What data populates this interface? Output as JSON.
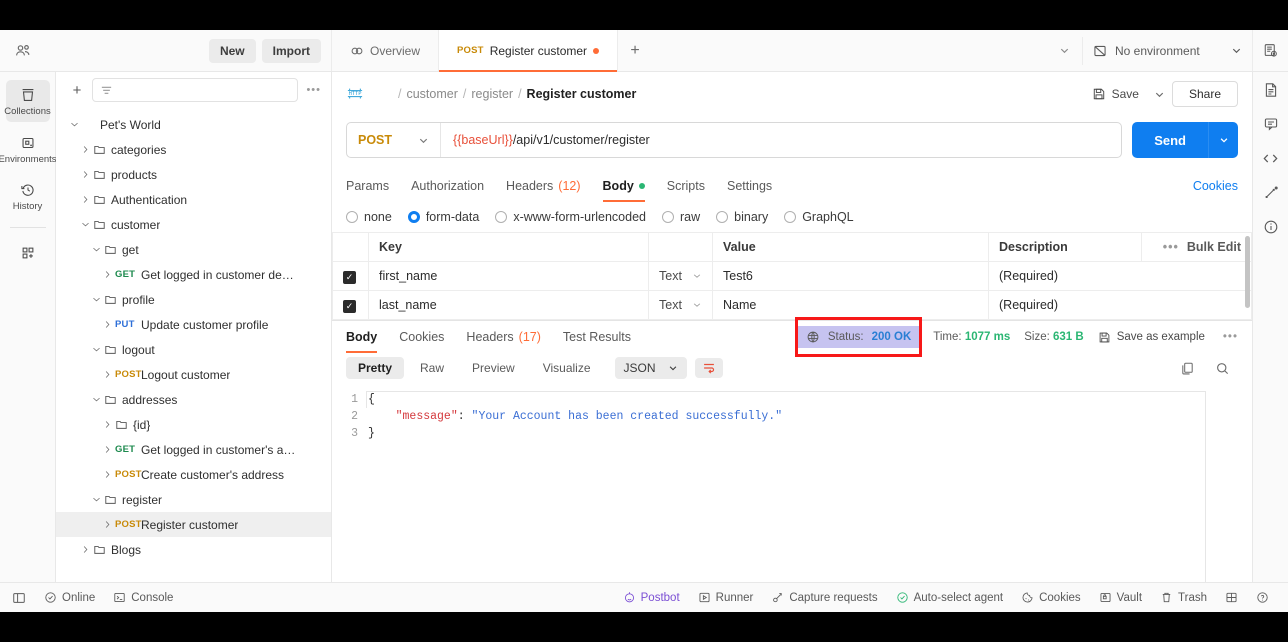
{
  "topbar": {
    "user_icon": "users-icon",
    "new_label": "New",
    "import_label": "Import",
    "environment": "No environment",
    "env_icon": "environment-icon",
    "tabs": [
      {
        "label": "Overview",
        "icon": "overview-icon",
        "method": "",
        "unsaved": false,
        "active": false
      },
      {
        "label": "Register customer",
        "icon": "",
        "method": "POST",
        "unsaved": true,
        "active": true
      }
    ],
    "new_tab_label": "+"
  },
  "rail": {
    "items": [
      {
        "label": "Collections",
        "icon": "collections-icon",
        "active": true
      },
      {
        "label": "Environments",
        "icon": "environments-icon",
        "active": false
      },
      {
        "label": "History",
        "icon": "history-icon",
        "active": false
      }
    ],
    "apps_icon": "apps-grid-icon"
  },
  "sidebar": {
    "add_label": "+",
    "filter_icon": "filter-icon",
    "filter_placeholder": "",
    "more_label": "•••",
    "tree": [
      {
        "indent": 0,
        "twisty": "down",
        "kind": "collection",
        "label": "Pet's World",
        "selected": false
      },
      {
        "indent": 1,
        "twisty": "right",
        "kind": "folder",
        "label": "categories",
        "selected": false
      },
      {
        "indent": 1,
        "twisty": "right",
        "kind": "folder",
        "label": "products",
        "selected": false
      },
      {
        "indent": 1,
        "twisty": "right",
        "kind": "folder",
        "label": "Authentication",
        "selected": false
      },
      {
        "indent": 1,
        "twisty": "down",
        "kind": "folder",
        "label": "customer",
        "selected": false
      },
      {
        "indent": 2,
        "twisty": "down",
        "kind": "folder",
        "label": "get",
        "selected": false
      },
      {
        "indent": 3,
        "twisty": "right",
        "kind": "request",
        "method": "GET",
        "label": "Get logged in customer de…",
        "selected": false
      },
      {
        "indent": 2,
        "twisty": "down",
        "kind": "folder",
        "label": "profile",
        "selected": false
      },
      {
        "indent": 3,
        "twisty": "right",
        "kind": "request",
        "method": "PUT",
        "label": "Update customer profile",
        "selected": false
      },
      {
        "indent": 2,
        "twisty": "down",
        "kind": "folder",
        "label": "logout",
        "selected": false
      },
      {
        "indent": 3,
        "twisty": "right",
        "kind": "request",
        "method": "POST",
        "label": "Logout customer",
        "selected": false
      },
      {
        "indent": 2,
        "twisty": "down",
        "kind": "folder",
        "label": "addresses",
        "selected": false
      },
      {
        "indent": 3,
        "twisty": "right",
        "kind": "folder",
        "label": "{id}",
        "selected": false
      },
      {
        "indent": 3,
        "twisty": "right",
        "kind": "request",
        "method": "GET",
        "label": "Get logged in customer's a…",
        "selected": false
      },
      {
        "indent": 3,
        "twisty": "right",
        "kind": "request",
        "method": "POST",
        "label": "Create customer's address",
        "selected": false
      },
      {
        "indent": 2,
        "twisty": "down",
        "kind": "folder",
        "label": "register",
        "selected": false
      },
      {
        "indent": 3,
        "twisty": "right",
        "kind": "request",
        "method": "POST",
        "label": "Register customer",
        "selected": true
      },
      {
        "indent": 1,
        "twisty": "right",
        "kind": "folder",
        "label": "Blogs",
        "selected": false
      }
    ]
  },
  "request": {
    "protocol_icon": "http-icon",
    "breadcrumb": [
      "customer",
      "register"
    ],
    "breadcrumb_current": "Register customer",
    "save_label": "Save",
    "share_label": "Share",
    "method": "POST",
    "url_variable": "{{baseUrl}}",
    "url_path": "/api/v1/customer/register",
    "send_label": "Send",
    "tabs": [
      {
        "label": "Params",
        "count": "",
        "dot": false,
        "active": false
      },
      {
        "label": "Authorization",
        "count": "",
        "dot": false,
        "active": false
      },
      {
        "label": "Headers",
        "count": "(12)",
        "dot": false,
        "active": false
      },
      {
        "label": "Body",
        "count": "",
        "dot": true,
        "active": true
      },
      {
        "label": "Scripts",
        "count": "",
        "dot": false,
        "active": false
      },
      {
        "label": "Settings",
        "count": "",
        "dot": false,
        "active": false
      }
    ],
    "cookies_label": "Cookies",
    "body_types": [
      {
        "label": "none",
        "selected": false
      },
      {
        "label": "form-data",
        "selected": true
      },
      {
        "label": "x-www-form-urlencoded",
        "selected": false
      },
      {
        "label": "raw",
        "selected": false
      },
      {
        "label": "binary",
        "selected": false
      },
      {
        "label": "GraphQL",
        "selected": false
      }
    ],
    "table": {
      "headers": [
        "Key",
        "Value",
        "Description"
      ],
      "bulk_edit_label": "Bulk Edit",
      "bulk_dots": "•••",
      "rows": [
        {
          "checked": true,
          "key": "first_name",
          "type": "Text",
          "value": "Test6",
          "description": "(Required)"
        },
        {
          "checked": true,
          "key": "last_name",
          "type": "Text",
          "value": "Name",
          "description": "(Required)"
        }
      ]
    }
  },
  "response": {
    "tabs": [
      {
        "label": "Body",
        "count": "",
        "active": true
      },
      {
        "label": "Cookies",
        "count": "",
        "active": false
      },
      {
        "label": "Headers",
        "count": "(17)",
        "active": false
      },
      {
        "label": "Test Results",
        "count": "",
        "active": false
      }
    ],
    "status_icon": "globe-icon",
    "status_label": "Status:",
    "status_value": "200 OK",
    "time_label": "Time:",
    "time_value": "1077 ms",
    "size_label": "Size:",
    "size_value": "631 B",
    "save_example_label": "Save as example",
    "more_label": "•••",
    "highlight_color": "#f71818",
    "selection_color": "#c6c3f0",
    "view_modes": [
      {
        "label": "Pretty",
        "active": true
      },
      {
        "label": "Raw",
        "active": false
      },
      {
        "label": "Preview",
        "active": false
      },
      {
        "label": "Visualize",
        "active": false
      }
    ],
    "format": "JSON",
    "wrap_icon": "wrap-lines-icon",
    "copy_icon": "copy-icon",
    "search_icon": "search-icon",
    "code_lines": [
      {
        "n": "1",
        "tokens": [
          {
            "t": "punc",
            "v": "{"
          }
        ]
      },
      {
        "n": "2",
        "tokens": [
          {
            "t": "punc",
            "v": "    "
          },
          {
            "t": "key",
            "v": "\"message\""
          },
          {
            "t": "punc",
            "v": ": "
          },
          {
            "t": "str",
            "v": "\"Your Account has been created successfully.\""
          }
        ]
      },
      {
        "n": "3",
        "tokens": [
          {
            "t": "punc",
            "v": "}"
          }
        ]
      }
    ]
  },
  "right_rail": {
    "items": [
      {
        "icon": "env-quick-look-icon"
      },
      {
        "icon": "documentation-icon"
      },
      {
        "icon": "comments-icon"
      },
      {
        "icon": "code-snippet-icon"
      },
      {
        "icon": "run-in-postman-icon"
      },
      {
        "icon": "info-circle-icon"
      }
    ]
  },
  "statusbar": {
    "left": [
      {
        "label": "",
        "icon": "sidebar-toggle-icon"
      },
      {
        "label": "Online",
        "icon": "online-check-icon"
      },
      {
        "label": "Console",
        "icon": "console-icon"
      }
    ],
    "right": [
      {
        "label": "Postbot",
        "icon": "postbot-icon",
        "accent": "#7b4fd4"
      },
      {
        "label": "Runner",
        "icon": "runner-icon",
        "accent": ""
      },
      {
        "label": "Capture requests",
        "icon": "capture-icon",
        "accent": ""
      },
      {
        "label": "Auto-select agent",
        "icon": "agent-check-icon",
        "accent": ""
      },
      {
        "label": "Cookies",
        "icon": "cookie-icon",
        "accent": ""
      },
      {
        "label": "Vault",
        "icon": "vault-icon",
        "accent": ""
      },
      {
        "label": "Trash",
        "icon": "trash-icon",
        "accent": ""
      },
      {
        "label": "",
        "icon": "layout-icon",
        "accent": ""
      },
      {
        "label": "",
        "icon": "help-icon",
        "accent": ""
      }
    ]
  }
}
